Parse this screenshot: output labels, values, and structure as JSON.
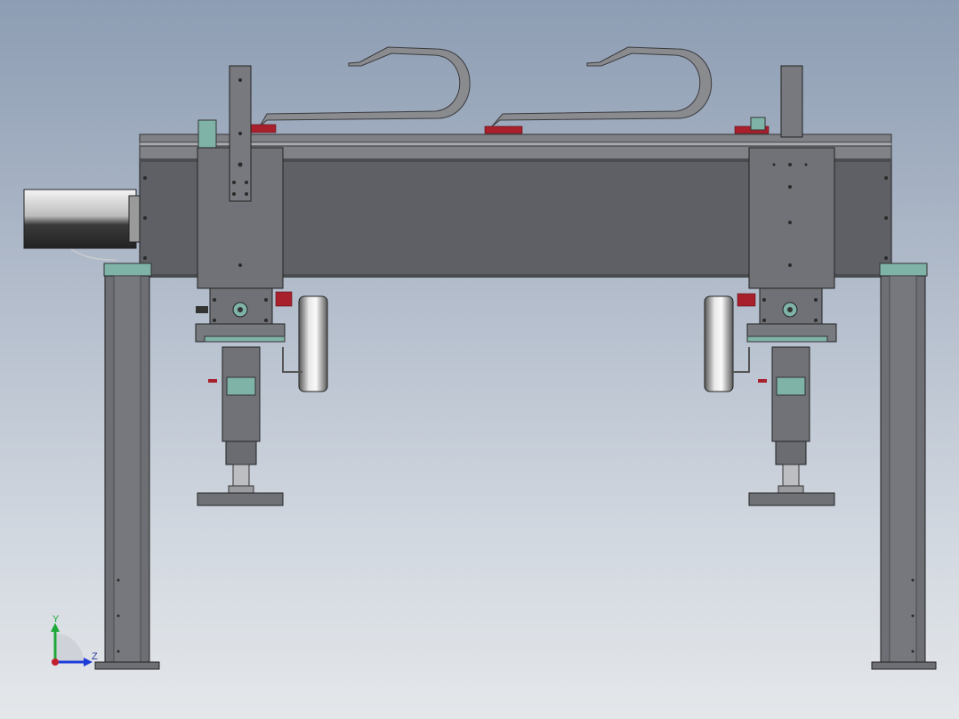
{
  "viewport": {
    "background_top": "#8d9db3",
    "background_bottom": "#e4e7ea"
  },
  "model": {
    "part_color": "#6f7176",
    "beam_color": "#5e6065",
    "accent_teal": "#7fb3a8",
    "accent_red": "#a8202c"
  },
  "triad": {
    "y_label": "Y",
    "z_label": "Z",
    "y_color": "#1fa83a",
    "z_color": "#1f3cd8",
    "origin_color": "#c2202c"
  }
}
